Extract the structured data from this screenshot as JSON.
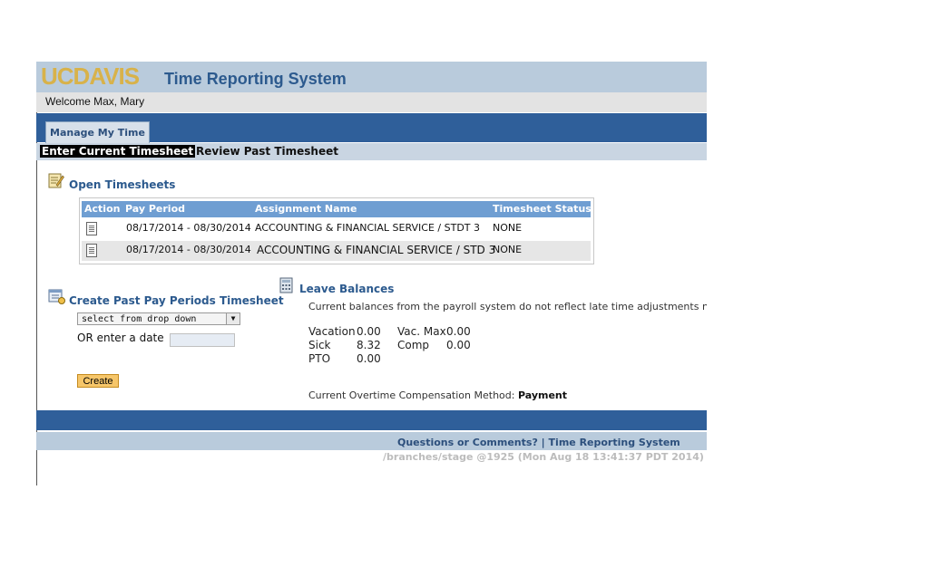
{
  "header": {
    "logo": "UCDAVIS",
    "title": "Time Reporting System"
  },
  "welcome": "Welcome Max, Mary",
  "tabs": [
    {
      "label": "Manage My Time"
    }
  ],
  "subnav": {
    "active": "Enter Current Timesheet",
    "other": "Review Past Timesheet"
  },
  "open_timesheets": {
    "title": "Open Timesheets",
    "columns": [
      "Action",
      "Pay Period",
      "Assignment Name",
      "Timesheet Status"
    ],
    "rows": [
      {
        "pay_period": "08/17/2014 - 08/30/2014",
        "assignment": "ACCOUNTING & FINANCIAL SERVICE / STDT 3",
        "status": "NONE"
      },
      {
        "pay_period": "08/17/2014 - 08/30/2014",
        "assignment": "ACCOUNTING & FINANCIAL SERVICE / STD 3",
        "status": "NONE"
      }
    ]
  },
  "past_periods": {
    "title": "Create Past Pay Periods Timesheet",
    "dropdown_value": "select from drop down",
    "or_label": "OR enter a date",
    "date_value": "",
    "create_label": "Create"
  },
  "leave": {
    "title": "Leave Balances",
    "description": "Current balances from the payroll system do not reflect late time adjustments nor",
    "vacation_label": "Vacation",
    "vacation_value": "0.00",
    "vac_max_label": "Vac. Max",
    "vac_max_value": "0.00",
    "sick_label": "Sick",
    "sick_value": "8.32",
    "comp_label": "Comp",
    "comp_value": "0.00",
    "pto_label": "PTO",
    "pto_value": "0.00",
    "overtime_label": "Current Overtime Compensation Method:",
    "overtime_value": "Payment"
  },
  "footer": {
    "questions": "Questions or Comments?",
    "separator": "|",
    "system_link": "Time Reporting System",
    "version": "/branches/stage @1925 (Mon Aug 18 13:41:37 PDT 2014)"
  }
}
